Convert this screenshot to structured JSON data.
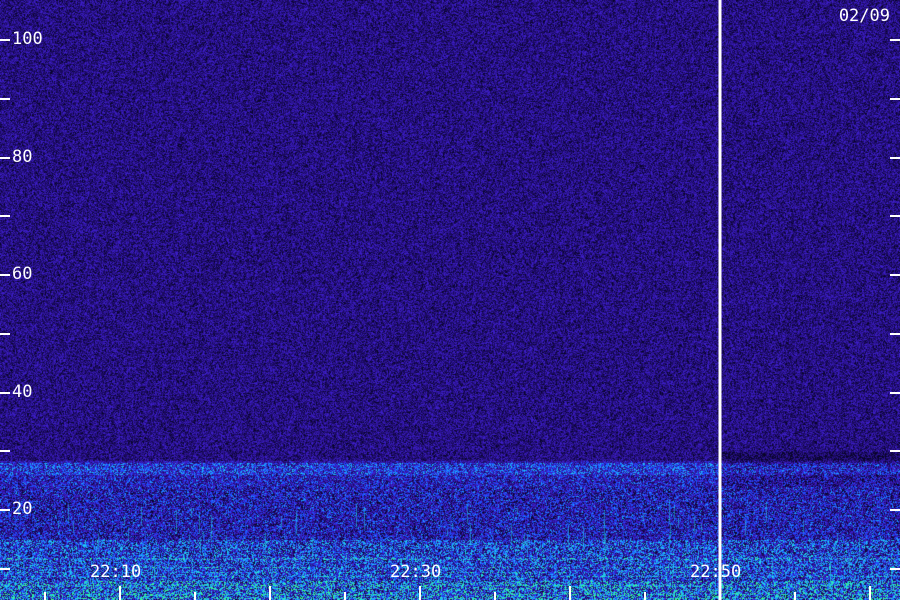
{
  "chart_data": {
    "type": "heatmap",
    "title": "",
    "date_label": "02/09",
    "xlabel": "",
    "ylabel": "",
    "x_tick_labels": [
      "22:10",
      "22:30",
      "22:50"
    ],
    "x_tick_values": [
      "22:10",
      "22:30",
      "22:50"
    ],
    "x_range": [
      "22:02",
      "23:02"
    ],
    "y_tick_labels": [
      "100",
      "80",
      "60",
      "40",
      "20"
    ],
    "y_tick_values": [
      100,
      80,
      60,
      40,
      20
    ],
    "y_minor_tick_values": [
      110,
      90,
      70,
      50,
      30,
      10
    ],
    "y_range": [
      0,
      110
    ],
    "data_gap": {
      "time": "22:50",
      "description_visible": false
    },
    "bands": [
      {
        "y_from": 0,
        "y_to": 10,
        "intensity": "high"
      },
      {
        "y_from": 10,
        "y_to": 20,
        "intensity": "medium"
      },
      {
        "y_from": 20,
        "y_to": 28,
        "intensity": "low-medium"
      },
      {
        "y_from": 28,
        "y_to": 110,
        "intensity": "background"
      }
    ],
    "colors": {
      "background": "#1a0a5e",
      "low": "#3a1ab0",
      "mid": "#1e5aff",
      "high": "#22d8e8",
      "peak": "#39ff8a",
      "gap": "#ffffff",
      "text": "#ffffff"
    },
    "grid": false
  }
}
